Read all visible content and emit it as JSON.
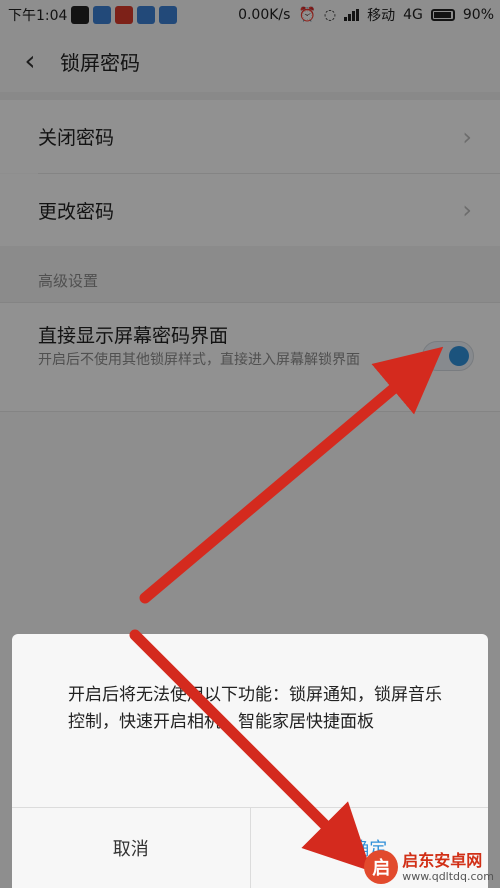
{
  "status_bar": {
    "time": "下午1:04",
    "speed": "0.00K/s",
    "carrier": "移动",
    "network": "4G",
    "battery": "90%",
    "app_icons": [
      "qq-icon",
      "app-icon",
      "app-icon",
      "app-icon",
      "app-icon"
    ]
  },
  "header": {
    "title": "锁屏密码"
  },
  "rows": [
    {
      "label": "关闭密码"
    },
    {
      "label": "更改密码"
    }
  ],
  "advanced": {
    "section_label": "高级设置",
    "title": "直接显示屏幕密码界面",
    "description": "开启后不使用其他锁屏样式，直接进入屏幕解锁界面",
    "toggle_on": true
  },
  "dialog": {
    "message": "开启后将无法使用以下功能：锁屏通知，锁屏音乐控制，快速开启相机，智能家居快捷面板",
    "cancel_label": "取消",
    "ok_label": "确定"
  },
  "watermark": {
    "name": "启东安卓网",
    "url": "www.qdltdq.com"
  },
  "colors": {
    "accent": "#2f8fd8",
    "arrow": "#d42a1e"
  }
}
